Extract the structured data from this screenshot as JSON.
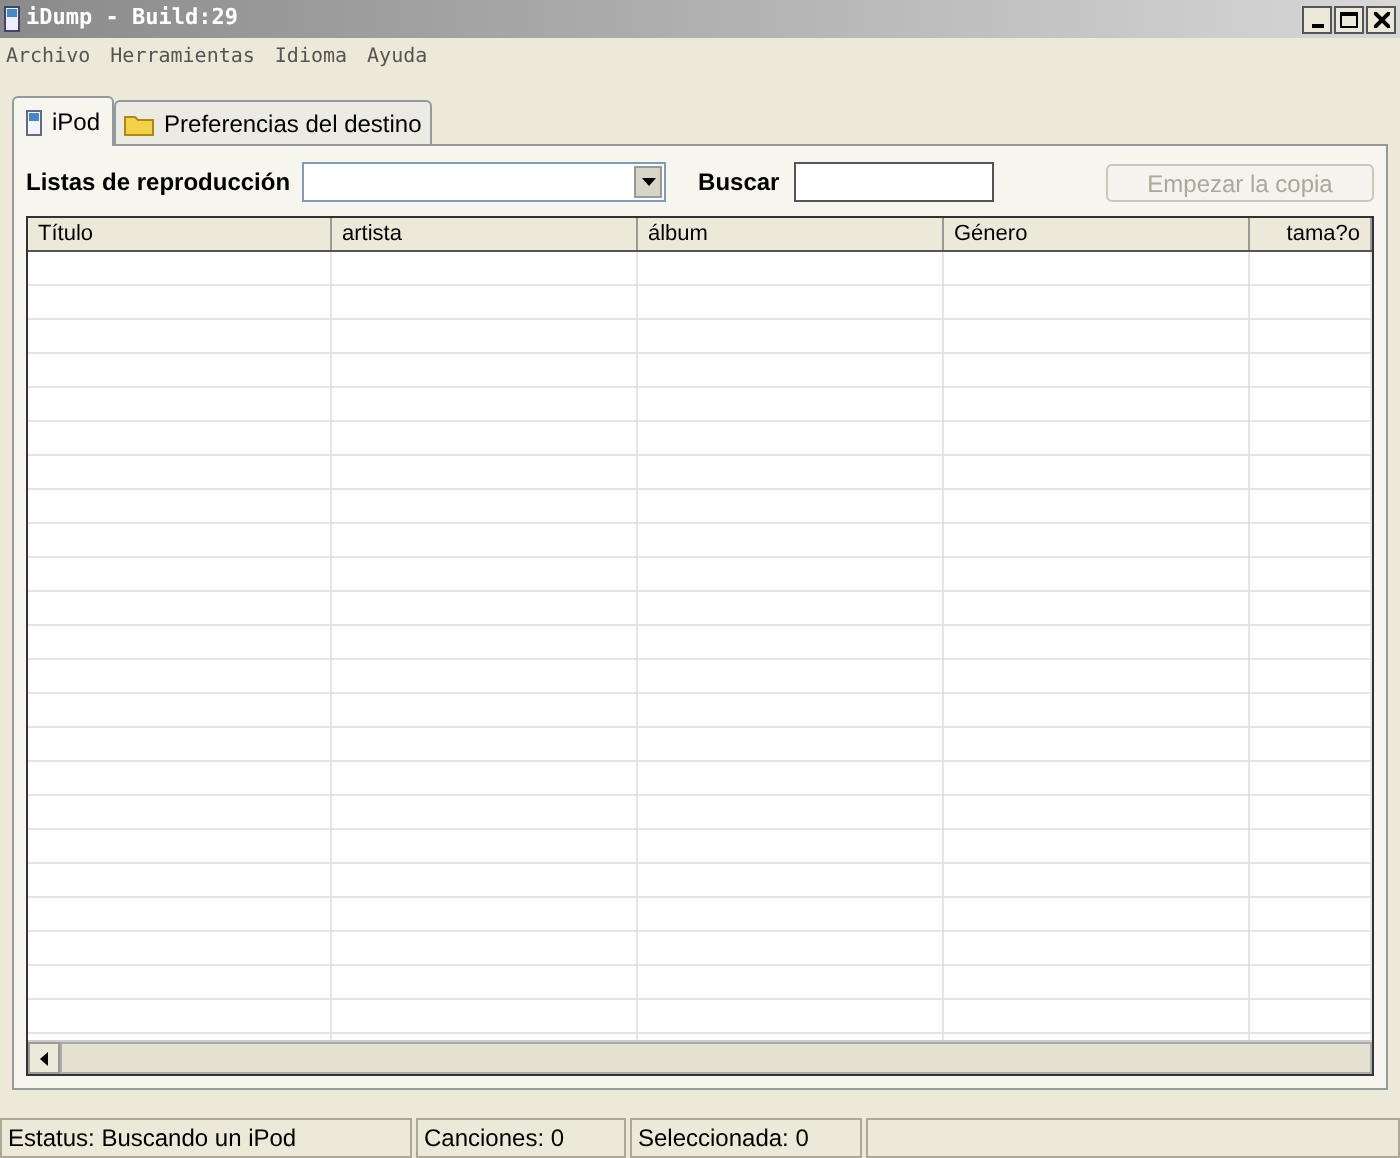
{
  "window": {
    "title": "iDump - Build:29"
  },
  "menu": [
    "Archivo",
    "Herramientas",
    "Idioma",
    "Ayuda"
  ],
  "tabs": [
    {
      "label": "iPod",
      "selected": true
    },
    {
      "label": "Preferencias del destino",
      "selected": false
    }
  ],
  "toolbar": {
    "playlist_label": "Listas de reproducción",
    "search_label": "Buscar",
    "copy_button": {
      "label": "Empezar la copia",
      "disabled": true
    }
  },
  "table": {
    "columns": [
      "Título",
      "artista",
      "álbum",
      "Género",
      "tama?o"
    ]
  },
  "status_bar": [
    "Estatus: Buscando un iPod",
    "Canciones: 0",
    "Seleccionada: 0"
  ]
}
